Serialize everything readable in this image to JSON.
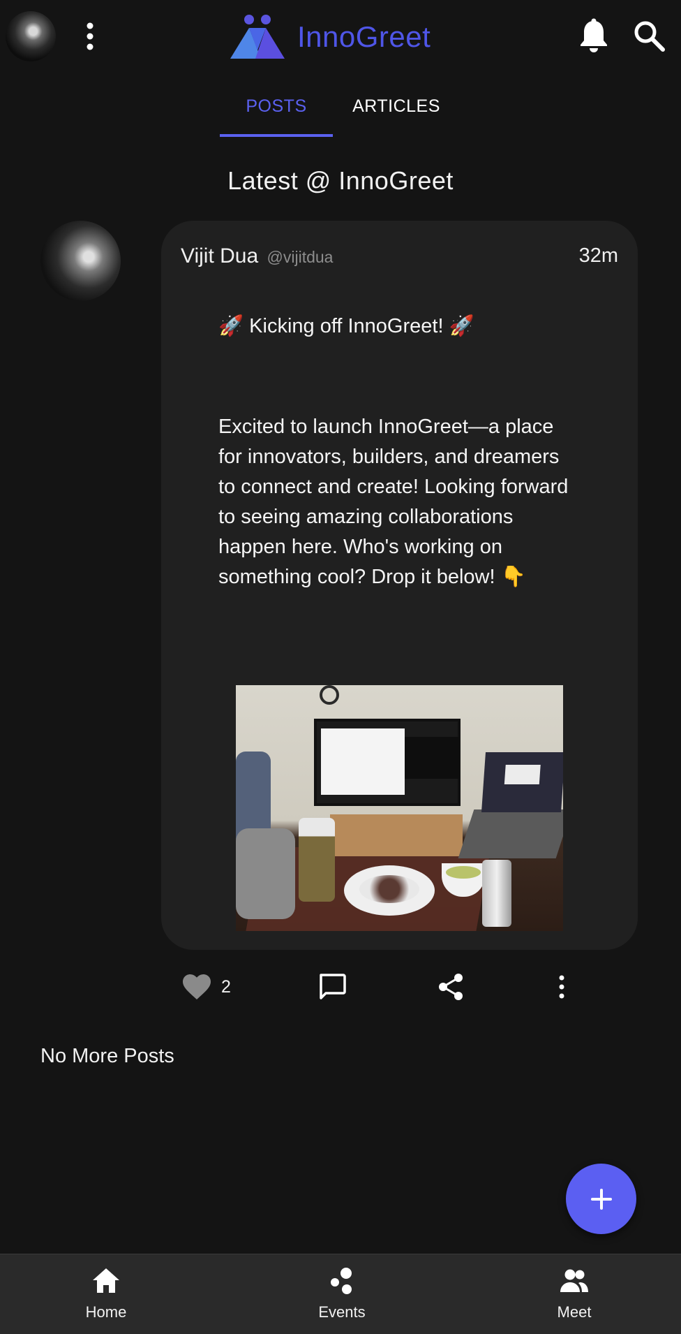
{
  "app": {
    "name": "InnoGreet",
    "accent_color": "#5b61f0",
    "background_color": "#141414"
  },
  "header": {
    "avatar_icon": "profile-avatar",
    "menu_icon": "more-vert-icon",
    "logo_text": "InnoGreet",
    "notifications_icon": "bell-icon",
    "search_icon": "search-icon"
  },
  "tabs": [
    {
      "label": "POSTS",
      "active": true
    },
    {
      "label": "ARTICLES",
      "active": false
    }
  ],
  "feed": {
    "title": "Latest @ InnoGreet",
    "end_text": "No More Posts"
  },
  "post": {
    "author_name": "Vijit Dua",
    "author_handle": "@vijitdua",
    "time_ago": "32m",
    "headline": "🚀 Kicking off InnoGreet! 🚀",
    "body": "Excited to launch InnoGreet—a place for innovators, builders, and dreamers to connect and create! Looking forward to seeing amazing collaborations happen here. Who's working on something cool? Drop it below! 👇",
    "image_icon": "desk-setup-photo",
    "likes": "2",
    "actions": [
      "like-icon",
      "comment-icon",
      "share-icon",
      "more-vert-icon"
    ]
  },
  "fab": {
    "icon": "plus-icon"
  },
  "bottom_nav": [
    {
      "label": "Home",
      "icon": "home-icon"
    },
    {
      "label": "Events",
      "icon": "events-icon"
    },
    {
      "label": "Meet",
      "icon": "people-icon"
    }
  ]
}
